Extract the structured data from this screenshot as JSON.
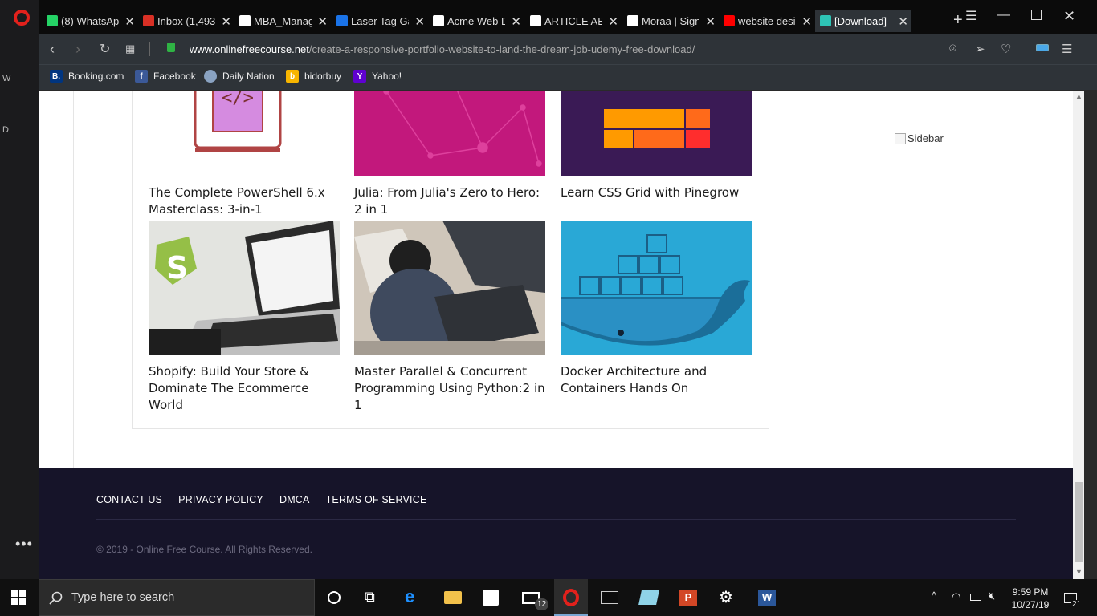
{
  "tabs": [
    {
      "title": "(8) WhatsAp",
      "icon": "whatsapp-icon",
      "color": "#25d366"
    },
    {
      "title": "Inbox (1,493",
      "icon": "gmail-icon",
      "color": "#d93025"
    },
    {
      "title": "MBA_Manag",
      "icon": "document-icon",
      "color": "#ffffff"
    },
    {
      "title": "Laser Tag Ga",
      "icon": "chart-icon",
      "color": "#1a73e8"
    },
    {
      "title": "Acme Web D",
      "icon": "document-icon",
      "color": "#ffffff"
    },
    {
      "title": "ARTICLE ABC",
      "icon": "document-icon",
      "color": "#ffffff"
    },
    {
      "title": "Moraa | Sign",
      "icon": "document-icon",
      "color": "#ffffff"
    },
    {
      "title": "website desi",
      "icon": "youtube-icon",
      "color": "#ff0000"
    },
    {
      "title": "[Download]",
      "icon": "site-icon",
      "color": "#2ec4b6"
    }
  ],
  "address": {
    "domain": "www.onlinefreecourse.net",
    "path": "/create-a-responsive-portfolio-website-to-land-the-dream-job-udemy-free-download/"
  },
  "bookmarks": [
    {
      "label": "Booking.com",
      "glyph": "B.",
      "color": "#003580"
    },
    {
      "label": "Facebook",
      "glyph": "f",
      "color": "#3b5998"
    },
    {
      "label": "Daily Nation",
      "glyph": "",
      "color": "#8aa3c2"
    },
    {
      "label": "bidorbuy",
      "glyph": "b",
      "color": "#f7b500"
    },
    {
      "label": "Yahoo!",
      "glyph": "Y",
      "color": "#5f01d1"
    }
  ],
  "courses": [
    {
      "title": "The Complete PowerShell 6.x Masterclass: 3-in-1"
    },
    {
      "title": "Julia: From Julia's Zero to Hero: 2 in 1"
    },
    {
      "title": "Learn CSS Grid with Pinegrow"
    },
    {
      "title": "Shopify: Build Your Store & Dominate The Ecommerce World"
    },
    {
      "title": "Master Parallel & Concurrent Programming Using Python:2 in 1"
    },
    {
      "title": "Docker Architecture and Containers Hands On"
    }
  ],
  "sidebar_alt": "Sidebar",
  "footer": {
    "links": [
      "CONTACT US",
      "PRIVACY POLICY",
      "DMCA",
      "TERMS OF SERVICE"
    ],
    "copyright": "© 2019 - Online Free Course. All Rights Reserved."
  },
  "taskbar": {
    "search_placeholder": "Type here to search",
    "mail_badge": "12",
    "time": "9:59 PM",
    "date": "10/27/19",
    "notifications": "21"
  }
}
